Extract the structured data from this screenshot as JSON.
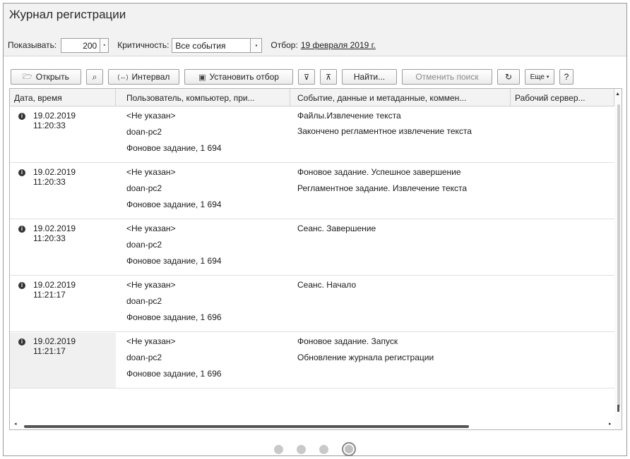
{
  "window": {
    "title": "Журнал регистрации"
  },
  "filters": {
    "show_label": "Показывать:",
    "show_value": "200",
    "criticality_label": "Критичность:",
    "criticality_value": "Все события",
    "selection_label": "Отбор:",
    "selection_value": "19 февраля 2019 г."
  },
  "toolbar": {
    "open": "Открыть",
    "interval": "Интервал",
    "set_filter": "Установить отбор",
    "find": "Найти...",
    "cancel_search": "Отменить поиск",
    "more": "Еще",
    "help": "?"
  },
  "table": {
    "columns": [
      "Дата, время",
      "Пользователь, компьютер, при...",
      "Событие, данные и метаданные, коммен...",
      "Рабочий сервер..."
    ],
    "rows": [
      {
        "date": "19.02.2019",
        "time": "11:20:33",
        "user": "<Не указан>",
        "computer": "doan-pc2",
        "app": "Фоновое задание, 1 694",
        "event": "Файлы.Извлечение текста",
        "meta": "Закончено регламентное извлечение текста"
      },
      {
        "date": "19.02.2019",
        "time": "11:20:33",
        "user": "<Не указан>",
        "computer": "doan-pc2",
        "app": "Фоновое задание, 1 694",
        "event": "Фоновое задание. Успешное завершение",
        "meta": "Регламентное задание. Извлечение текста"
      },
      {
        "date": "19.02.2019",
        "time": "11:20:33",
        "user": "<Не указан>",
        "computer": "doan-pc2",
        "app": "Фоновое задание, 1 694",
        "event": "Сеанс. Завершение",
        "meta": ""
      },
      {
        "date": "19.02.2019",
        "time": "11:21:17",
        "user": "<Не указан>",
        "computer": "doan-pc2",
        "app": "Фоновое задание, 1 696",
        "event": "Сеанс. Начало",
        "meta": ""
      },
      {
        "date": "19.02.2019",
        "time": "11:21:17",
        "user": "<Не указан>",
        "computer": "doan-pc2",
        "app": "Фоновое задание, 1 696",
        "event": "Фоновое задание. Запуск",
        "meta": "Обновление журнала регистрации"
      }
    ]
  },
  "pager": {
    "count": 4,
    "active": 4
  }
}
